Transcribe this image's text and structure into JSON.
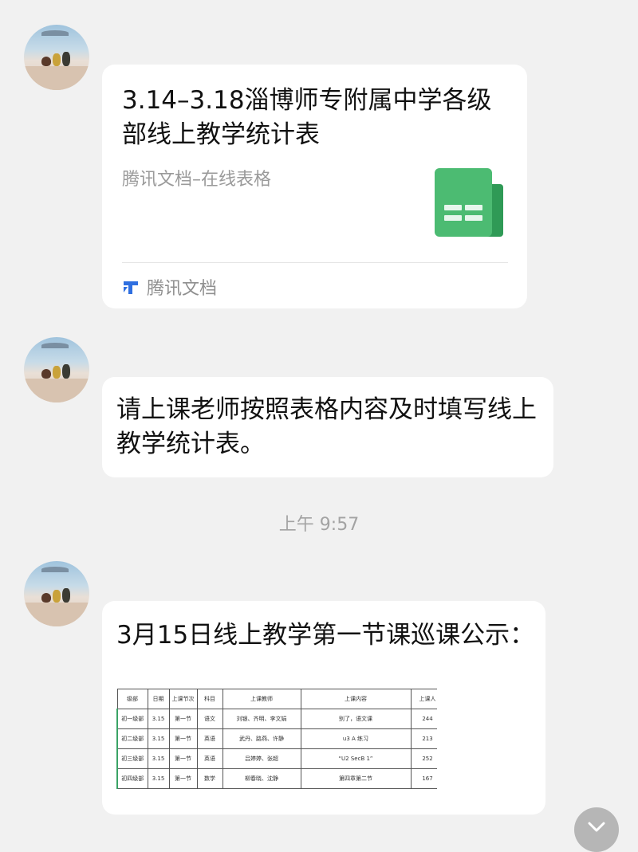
{
  "messages": {
    "card": {
      "title": "3.14–3.18淄博师专附属中学各级部线上教学统计表",
      "subtitle": "腾讯文档–在线表格",
      "footer": "腾讯文档",
      "icon": "spreadsheet-icon"
    },
    "text": "请上课老师按照表格内容及时填写线上教学统计表。",
    "timestamp": "上午 9:57",
    "notice": {
      "text": "3月15日线上教学第一节课巡课公示：",
      "table": {
        "headers": [
          "级部",
          "日期",
          "上课节次",
          "科目",
          "上课教师",
          "上课内容",
          "上课人"
        ],
        "rows": [
          [
            "初一级部",
            "3.15",
            "第一节",
            "语文",
            "刘银、齐明、李文娟",
            "别了，语文课",
            "244"
          ],
          [
            "初二级部",
            "3.15",
            "第一节",
            "英语",
            "武丹、路燕、许静",
            "u3 A 练习",
            "213"
          ],
          [
            "初三级部",
            "3.15",
            "第一节",
            "英语",
            "吕婷婷、张超",
            "“U2 SecB 1”",
            "252"
          ],
          [
            "初四级部",
            "3.15",
            "第一节",
            "数学",
            "柳春晓、沈静",
            "第四章第二节",
            "167"
          ]
        ]
      }
    }
  },
  "icons": {
    "avatar": "avatar",
    "scroll_down": "chevron-down-icon",
    "brand": "tencent-docs-logo"
  },
  "colors": {
    "background": "#f1f1f1",
    "bubble": "#ffffff",
    "sheet_green": "#4cbb72",
    "brand_blue": "#2f6fe0"
  }
}
